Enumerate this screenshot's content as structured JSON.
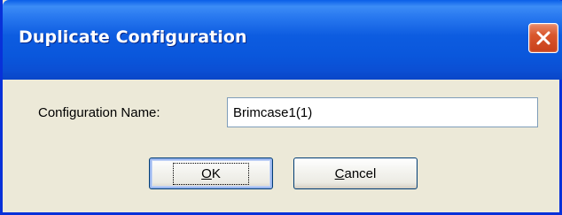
{
  "dialog": {
    "title": "Duplicate Configuration",
    "close_icon": "close-icon",
    "field_label": "Configuration Name:",
    "configuration_name_value": "Brimcase1(1)",
    "ok_label_mnemonic": "O",
    "ok_label_rest": "K",
    "cancel_label_mnemonic": "C",
    "cancel_label_rest": "ancel"
  },
  "colors": {
    "titlebar": "#0a57dc",
    "frame": "#0831d9",
    "client_background": "#ece9d8",
    "close_button": "#d9562c",
    "input_border": "#7f9db9",
    "button_border": "#003c74"
  }
}
